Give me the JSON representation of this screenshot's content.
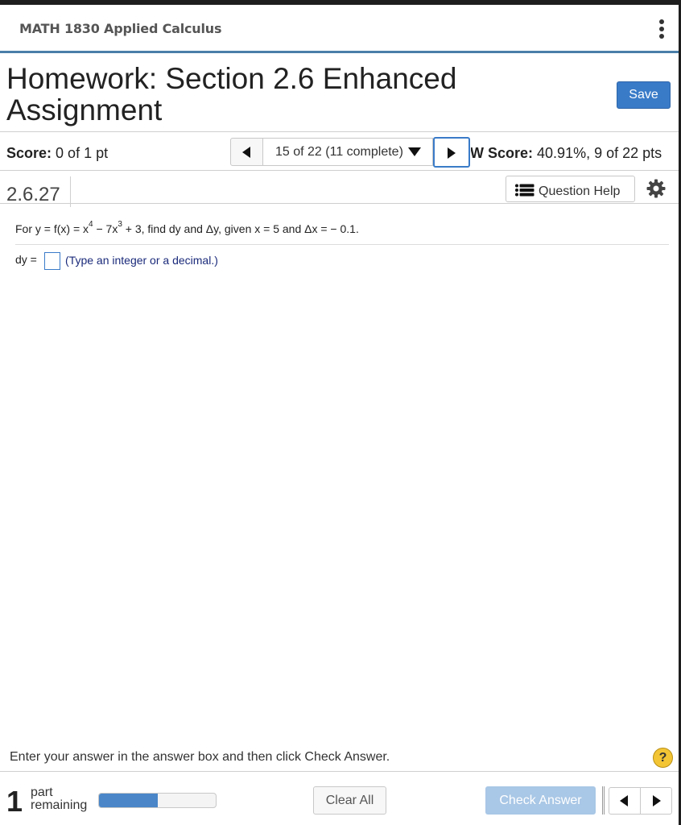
{
  "header": {
    "course_title": "MATH 1830 Applied Calculus",
    "homework_title": "Homework: Section 2.6 Enhanced Assignment",
    "save_label": "Save"
  },
  "score_bar": {
    "score_label": "Score:",
    "score_value": "0 of 1 pt",
    "question_selector": "15 of 22 (11 complete)",
    "hw_score_label": "HW Score:",
    "hw_score_value": "40.91%, 9 of 22 pts"
  },
  "question": {
    "number": "2.6.27",
    "help_label": "Question Help",
    "prompt_prefix": "For y = f(x) = x",
    "prompt_exp1": "4",
    "prompt_mid": " − 7x",
    "prompt_exp2": "3",
    "prompt_suffix": " + 3, find dy and Δy, given x = 5 and Δx = − 0.1.",
    "answer_label": "dy =",
    "answer_value": "",
    "answer_hint": "(Type an integer or a decimal.)"
  },
  "footer": {
    "instructions": "Enter your answer in the answer box and then click Check Answer.",
    "help_symbol": "?",
    "parts_count": "1",
    "parts_label_1": "part",
    "parts_label_2": "remaining",
    "progress_fraction": 0.5,
    "clear_label": "Clear All",
    "check_label": "Check Answer"
  },
  "icons": {
    "menu": "kebab-vertical-icon",
    "prev": "triangle-left-icon",
    "next": "triangle-right-icon",
    "dropdown": "triangle-down-icon",
    "help_list": "list-icon",
    "settings": "gear-icon"
  },
  "colors": {
    "accent_blue": "#3a7bc8",
    "header_rule": "#4a7fa9",
    "check_disabled": "#a9c7e6",
    "help_yellow": "#f3c535",
    "hint_text": "#1a2a7a"
  }
}
